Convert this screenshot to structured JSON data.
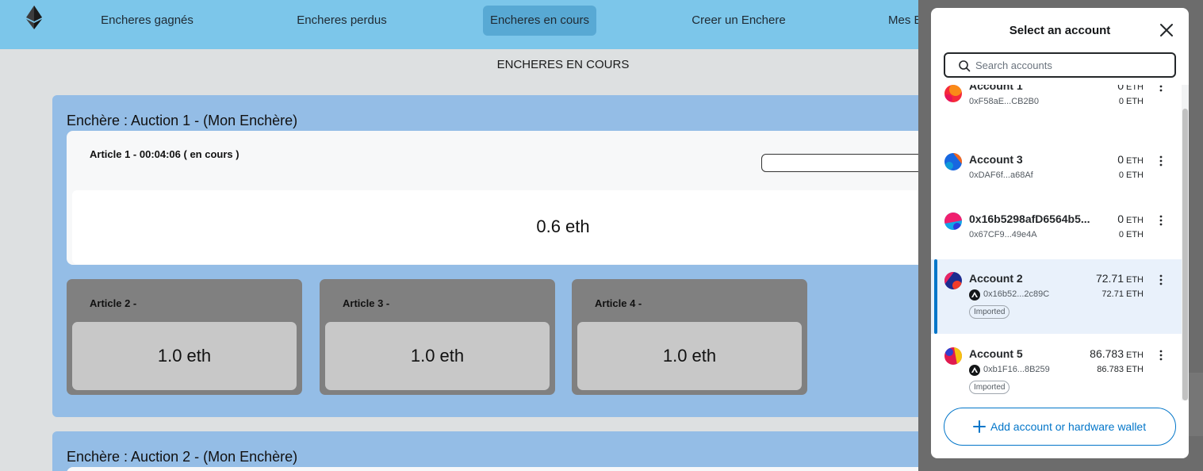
{
  "nav": {
    "items": [
      {
        "label": "Encheres gagnés"
      },
      {
        "label": "Encheres perdus"
      },
      {
        "label": "Encheres en cours",
        "active": true
      },
      {
        "label": "Creer un Enchere"
      },
      {
        "label": "Mes E"
      }
    ]
  },
  "page": {
    "heading": "ENCHERES EN COURS",
    "auctions": [
      {
        "title": "Enchère : Auction 1 - (Mon Enchère)",
        "current_article": {
          "label": "Article 1 - 00:04:06 ( en cours )",
          "price": "0.6 eth"
        },
        "articles": [
          {
            "label": "Article 2 -",
            "price": "1.0 eth"
          },
          {
            "label": "Article 3 -",
            "price": "1.0 eth"
          },
          {
            "label": "Article 4 -",
            "price": "1.0 eth"
          }
        ]
      },
      {
        "title": "Enchère : Auction 2 - (Mon Enchère)"
      }
    ]
  },
  "wallet": {
    "title": "Select an account",
    "search": {
      "placeholder": "Search accounts",
      "value": ""
    },
    "accounts": [
      {
        "name": "Account 1",
        "address": "0xF58aE...CB2B0",
        "balance": "0",
        "unit": "ETH",
        "fiat": "0 ETH",
        "selected": false,
        "imported": false
      },
      {
        "name": "Account 3",
        "address": "0xDAF6f...a68Af",
        "balance": "0",
        "unit": "ETH",
        "fiat": "0 ETH",
        "selected": false,
        "imported": false
      },
      {
        "name": "0x16b5298afD6564b5...",
        "address": "0x67CF9...49e4A",
        "balance": "0",
        "unit": "ETH",
        "fiat": "0 ETH",
        "selected": false,
        "imported": false
      },
      {
        "name": "Account 2",
        "address": "0x16b52...2c89C",
        "balance": "72.71",
        "unit": "ETH",
        "fiat": "72.71 ETH",
        "selected": true,
        "imported": true,
        "tag": "Imported"
      },
      {
        "name": "Account 5",
        "address": "0xb1F16...8B259",
        "balance": "86.783",
        "unit": "ETH",
        "fiat": "86.783 ETH",
        "selected": false,
        "imported": true,
        "tag": "Imported"
      }
    ],
    "add_button": "Add account or hardware wallet",
    "colors": {
      "accent": "#0376c9",
      "selected_bg": "#e9f1fb"
    }
  }
}
